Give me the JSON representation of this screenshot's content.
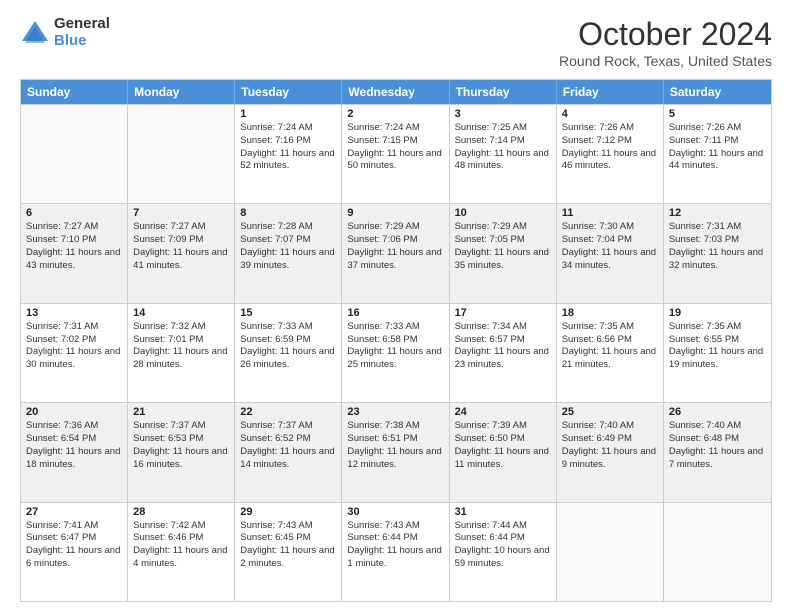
{
  "logo": {
    "general": "General",
    "blue": "Blue"
  },
  "header": {
    "month": "October 2024",
    "location": "Round Rock, Texas, United States"
  },
  "days": [
    "Sunday",
    "Monday",
    "Tuesday",
    "Wednesday",
    "Thursday",
    "Friday",
    "Saturday"
  ],
  "weeks": [
    [
      {
        "day": "",
        "sunrise": "",
        "sunset": "",
        "daylight": ""
      },
      {
        "day": "",
        "sunrise": "",
        "sunset": "",
        "daylight": ""
      },
      {
        "day": "1",
        "sunrise": "Sunrise: 7:24 AM",
        "sunset": "Sunset: 7:16 PM",
        "daylight": "Daylight: 11 hours and 52 minutes."
      },
      {
        "day": "2",
        "sunrise": "Sunrise: 7:24 AM",
        "sunset": "Sunset: 7:15 PM",
        "daylight": "Daylight: 11 hours and 50 minutes."
      },
      {
        "day": "3",
        "sunrise": "Sunrise: 7:25 AM",
        "sunset": "Sunset: 7:14 PM",
        "daylight": "Daylight: 11 hours and 48 minutes."
      },
      {
        "day": "4",
        "sunrise": "Sunrise: 7:26 AM",
        "sunset": "Sunset: 7:12 PM",
        "daylight": "Daylight: 11 hours and 46 minutes."
      },
      {
        "day": "5",
        "sunrise": "Sunrise: 7:26 AM",
        "sunset": "Sunset: 7:11 PM",
        "daylight": "Daylight: 11 hours and 44 minutes."
      }
    ],
    [
      {
        "day": "6",
        "sunrise": "Sunrise: 7:27 AM",
        "sunset": "Sunset: 7:10 PM",
        "daylight": "Daylight: 11 hours and 43 minutes."
      },
      {
        "day": "7",
        "sunrise": "Sunrise: 7:27 AM",
        "sunset": "Sunset: 7:09 PM",
        "daylight": "Daylight: 11 hours and 41 minutes."
      },
      {
        "day": "8",
        "sunrise": "Sunrise: 7:28 AM",
        "sunset": "Sunset: 7:07 PM",
        "daylight": "Daylight: 11 hours and 39 minutes."
      },
      {
        "day": "9",
        "sunrise": "Sunrise: 7:29 AM",
        "sunset": "Sunset: 7:06 PM",
        "daylight": "Daylight: 11 hours and 37 minutes."
      },
      {
        "day": "10",
        "sunrise": "Sunrise: 7:29 AM",
        "sunset": "Sunset: 7:05 PM",
        "daylight": "Daylight: 11 hours and 35 minutes."
      },
      {
        "day": "11",
        "sunrise": "Sunrise: 7:30 AM",
        "sunset": "Sunset: 7:04 PM",
        "daylight": "Daylight: 11 hours and 34 minutes."
      },
      {
        "day": "12",
        "sunrise": "Sunrise: 7:31 AM",
        "sunset": "Sunset: 7:03 PM",
        "daylight": "Daylight: 11 hours and 32 minutes."
      }
    ],
    [
      {
        "day": "13",
        "sunrise": "Sunrise: 7:31 AM",
        "sunset": "Sunset: 7:02 PM",
        "daylight": "Daylight: 11 hours and 30 minutes."
      },
      {
        "day": "14",
        "sunrise": "Sunrise: 7:32 AM",
        "sunset": "Sunset: 7:01 PM",
        "daylight": "Daylight: 11 hours and 28 minutes."
      },
      {
        "day": "15",
        "sunrise": "Sunrise: 7:33 AM",
        "sunset": "Sunset: 6:59 PM",
        "daylight": "Daylight: 11 hours and 26 minutes."
      },
      {
        "day": "16",
        "sunrise": "Sunrise: 7:33 AM",
        "sunset": "Sunset: 6:58 PM",
        "daylight": "Daylight: 11 hours and 25 minutes."
      },
      {
        "day": "17",
        "sunrise": "Sunrise: 7:34 AM",
        "sunset": "Sunset: 6:57 PM",
        "daylight": "Daylight: 11 hours and 23 minutes."
      },
      {
        "day": "18",
        "sunrise": "Sunrise: 7:35 AM",
        "sunset": "Sunset: 6:56 PM",
        "daylight": "Daylight: 11 hours and 21 minutes."
      },
      {
        "day": "19",
        "sunrise": "Sunrise: 7:35 AM",
        "sunset": "Sunset: 6:55 PM",
        "daylight": "Daylight: 11 hours and 19 minutes."
      }
    ],
    [
      {
        "day": "20",
        "sunrise": "Sunrise: 7:36 AM",
        "sunset": "Sunset: 6:54 PM",
        "daylight": "Daylight: 11 hours and 18 minutes."
      },
      {
        "day": "21",
        "sunrise": "Sunrise: 7:37 AM",
        "sunset": "Sunset: 6:53 PM",
        "daylight": "Daylight: 11 hours and 16 minutes."
      },
      {
        "day": "22",
        "sunrise": "Sunrise: 7:37 AM",
        "sunset": "Sunset: 6:52 PM",
        "daylight": "Daylight: 11 hours and 14 minutes."
      },
      {
        "day": "23",
        "sunrise": "Sunrise: 7:38 AM",
        "sunset": "Sunset: 6:51 PM",
        "daylight": "Daylight: 11 hours and 12 minutes."
      },
      {
        "day": "24",
        "sunrise": "Sunrise: 7:39 AM",
        "sunset": "Sunset: 6:50 PM",
        "daylight": "Daylight: 11 hours and 11 minutes."
      },
      {
        "day": "25",
        "sunrise": "Sunrise: 7:40 AM",
        "sunset": "Sunset: 6:49 PM",
        "daylight": "Daylight: 11 hours and 9 minutes."
      },
      {
        "day": "26",
        "sunrise": "Sunrise: 7:40 AM",
        "sunset": "Sunset: 6:48 PM",
        "daylight": "Daylight: 11 hours and 7 minutes."
      }
    ],
    [
      {
        "day": "27",
        "sunrise": "Sunrise: 7:41 AM",
        "sunset": "Sunset: 6:47 PM",
        "daylight": "Daylight: 11 hours and 6 minutes."
      },
      {
        "day": "28",
        "sunrise": "Sunrise: 7:42 AM",
        "sunset": "Sunset: 6:46 PM",
        "daylight": "Daylight: 11 hours and 4 minutes."
      },
      {
        "day": "29",
        "sunrise": "Sunrise: 7:43 AM",
        "sunset": "Sunset: 6:45 PM",
        "daylight": "Daylight: 11 hours and 2 minutes."
      },
      {
        "day": "30",
        "sunrise": "Sunrise: 7:43 AM",
        "sunset": "Sunset: 6:44 PM",
        "daylight": "Daylight: 11 hours and 1 minute."
      },
      {
        "day": "31",
        "sunrise": "Sunrise: 7:44 AM",
        "sunset": "Sunset: 6:44 PM",
        "daylight": "Daylight: 10 hours and 59 minutes."
      },
      {
        "day": "",
        "sunrise": "",
        "sunset": "",
        "daylight": ""
      },
      {
        "day": "",
        "sunrise": "",
        "sunset": "",
        "daylight": ""
      }
    ]
  ]
}
